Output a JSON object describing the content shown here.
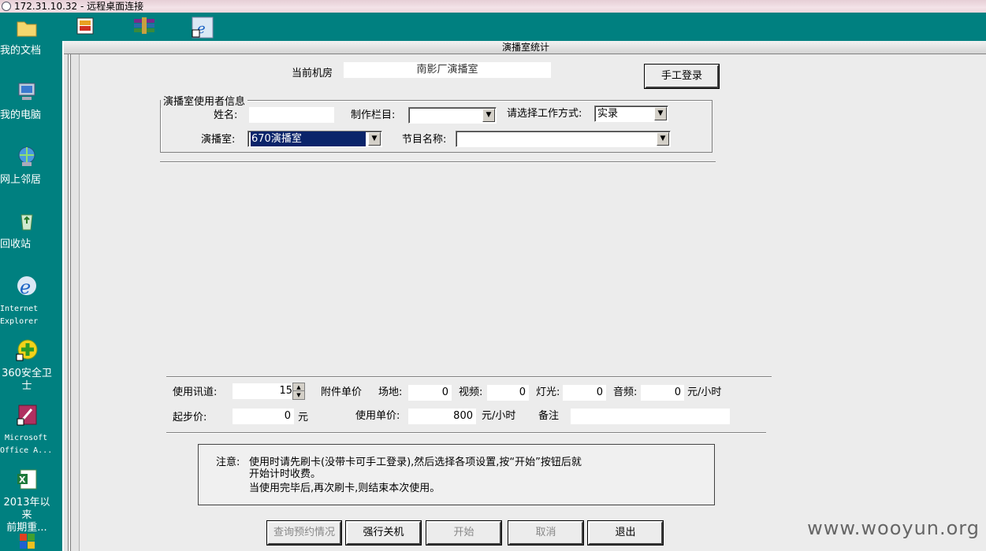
{
  "rdp": {
    "title": "172.31.10.32 - 远程桌面连接"
  },
  "desktop": {
    "icons": [
      {
        "label": "我的文档"
      },
      {
        "label": "我的电脑"
      },
      {
        "label": "网上邻居"
      },
      {
        "label": "回收站"
      },
      {
        "label": "Internet\nExplorer"
      },
      {
        "label": "360安全卫士"
      },
      {
        "label": "Microsoft\nOffice A..."
      },
      {
        "label": "2013年以来\n前期重..."
      }
    ]
  },
  "app": {
    "title": "演播室统计",
    "current_room_label": "当前机房",
    "current_room_value": "南影厂演播室",
    "manual_login_button": "手工登录",
    "user_info": {
      "legend": "演播室使用者信息",
      "name_label": "姓名:",
      "name_value": "",
      "column_label": "制作栏目:",
      "column_value": "",
      "work_mode_label": "请选择工作方式:",
      "work_mode_value": "实录",
      "studio_label": "演播室:",
      "studio_value": "670演播室",
      "program_label": "节目名称:",
      "program_value": ""
    },
    "pricing": {
      "usage_channel_label": "使用讯道:",
      "usage_channel_value": "15",
      "attachment_unit_label": "附件单价",
      "venue_label": "场地:",
      "venue_value": "0",
      "video_label": "视频:",
      "video_value": "0",
      "lighting_label": "灯光:",
      "lighting_value": "0",
      "audio_label": "音频:",
      "audio_value": "0",
      "unit_yuan_per_hour": "元/小时",
      "start_price_label": "起步价:",
      "start_price_value": "0",
      "yuan": "元",
      "usage_unit_price_label": "使用单价:",
      "usage_unit_price_value": "800",
      "usage_unit": "元/小时",
      "remark_label": "备注",
      "remark_value": ""
    },
    "note": {
      "prefix": "注意:",
      "line1": "使用时请先刷卡(没带卡可手工登录),然后选择各项设置,按“开始”按钮后就",
      "line2": "开始计时收费。",
      "line3": "当使用完毕后,再次刷卡,则结束本次使用。"
    },
    "buttons": {
      "query": "查询预约情况",
      "force_shutdown": "强行关机",
      "start": "开始",
      "cancel": "取消",
      "exit": "退出"
    }
  },
  "watermark": "www.wooyun.org",
  "colors": {
    "desktop": "#008080",
    "window": "#ececec",
    "selection": "#0a246a"
  }
}
